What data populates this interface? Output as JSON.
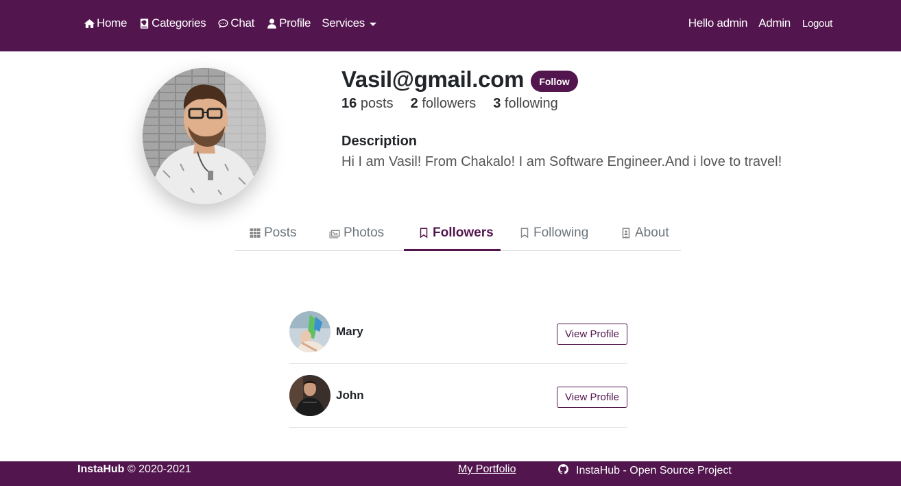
{
  "nav": {
    "left": [
      {
        "label": "Home",
        "icon": "home-icon"
      },
      {
        "label": "Categories",
        "icon": "book-icon"
      },
      {
        "label": "Chat",
        "icon": "chat-icon"
      },
      {
        "label": "Profile",
        "icon": "user-icon"
      },
      {
        "label": "Services",
        "icon": "chevron-down-icon"
      }
    ],
    "right": {
      "greeting": "Hello admin",
      "admin": "Admin",
      "logout": "Logout"
    }
  },
  "profile": {
    "username": "Vasil@gmail.com",
    "follow_label": "Follow",
    "stats": {
      "posts_count": "16",
      "posts_label": "posts",
      "followers_count": "2",
      "followers_label": "followers",
      "following_count": "3",
      "following_label": "following"
    },
    "description_title": "Description",
    "description_text": "Hi I am Vasil! From Chakalo! I am Software Engineer.And i love to travel!"
  },
  "tabs": [
    {
      "label": "Posts",
      "icon": "grid-icon"
    },
    {
      "label": "Photos",
      "icon": "images-icon"
    },
    {
      "label": "Followers",
      "icon": "bookmark-icon",
      "active": true
    },
    {
      "label": "Following",
      "icon": "bookmark-outline-icon"
    },
    {
      "label": "About",
      "icon": "id-card-icon"
    }
  ],
  "followers": [
    {
      "name": "Mary",
      "button": "View Profile"
    },
    {
      "name": "John",
      "button": "View Profile"
    }
  ],
  "footer": {
    "brand": "InstaHub",
    "copyright": "© 2020-2021",
    "portfolio": "My Portfolio",
    "github": "InstaHub - Open Source Project"
  },
  "colors": {
    "primary": "#52154e",
    "text": "#212529",
    "muted": "#6c757d"
  }
}
